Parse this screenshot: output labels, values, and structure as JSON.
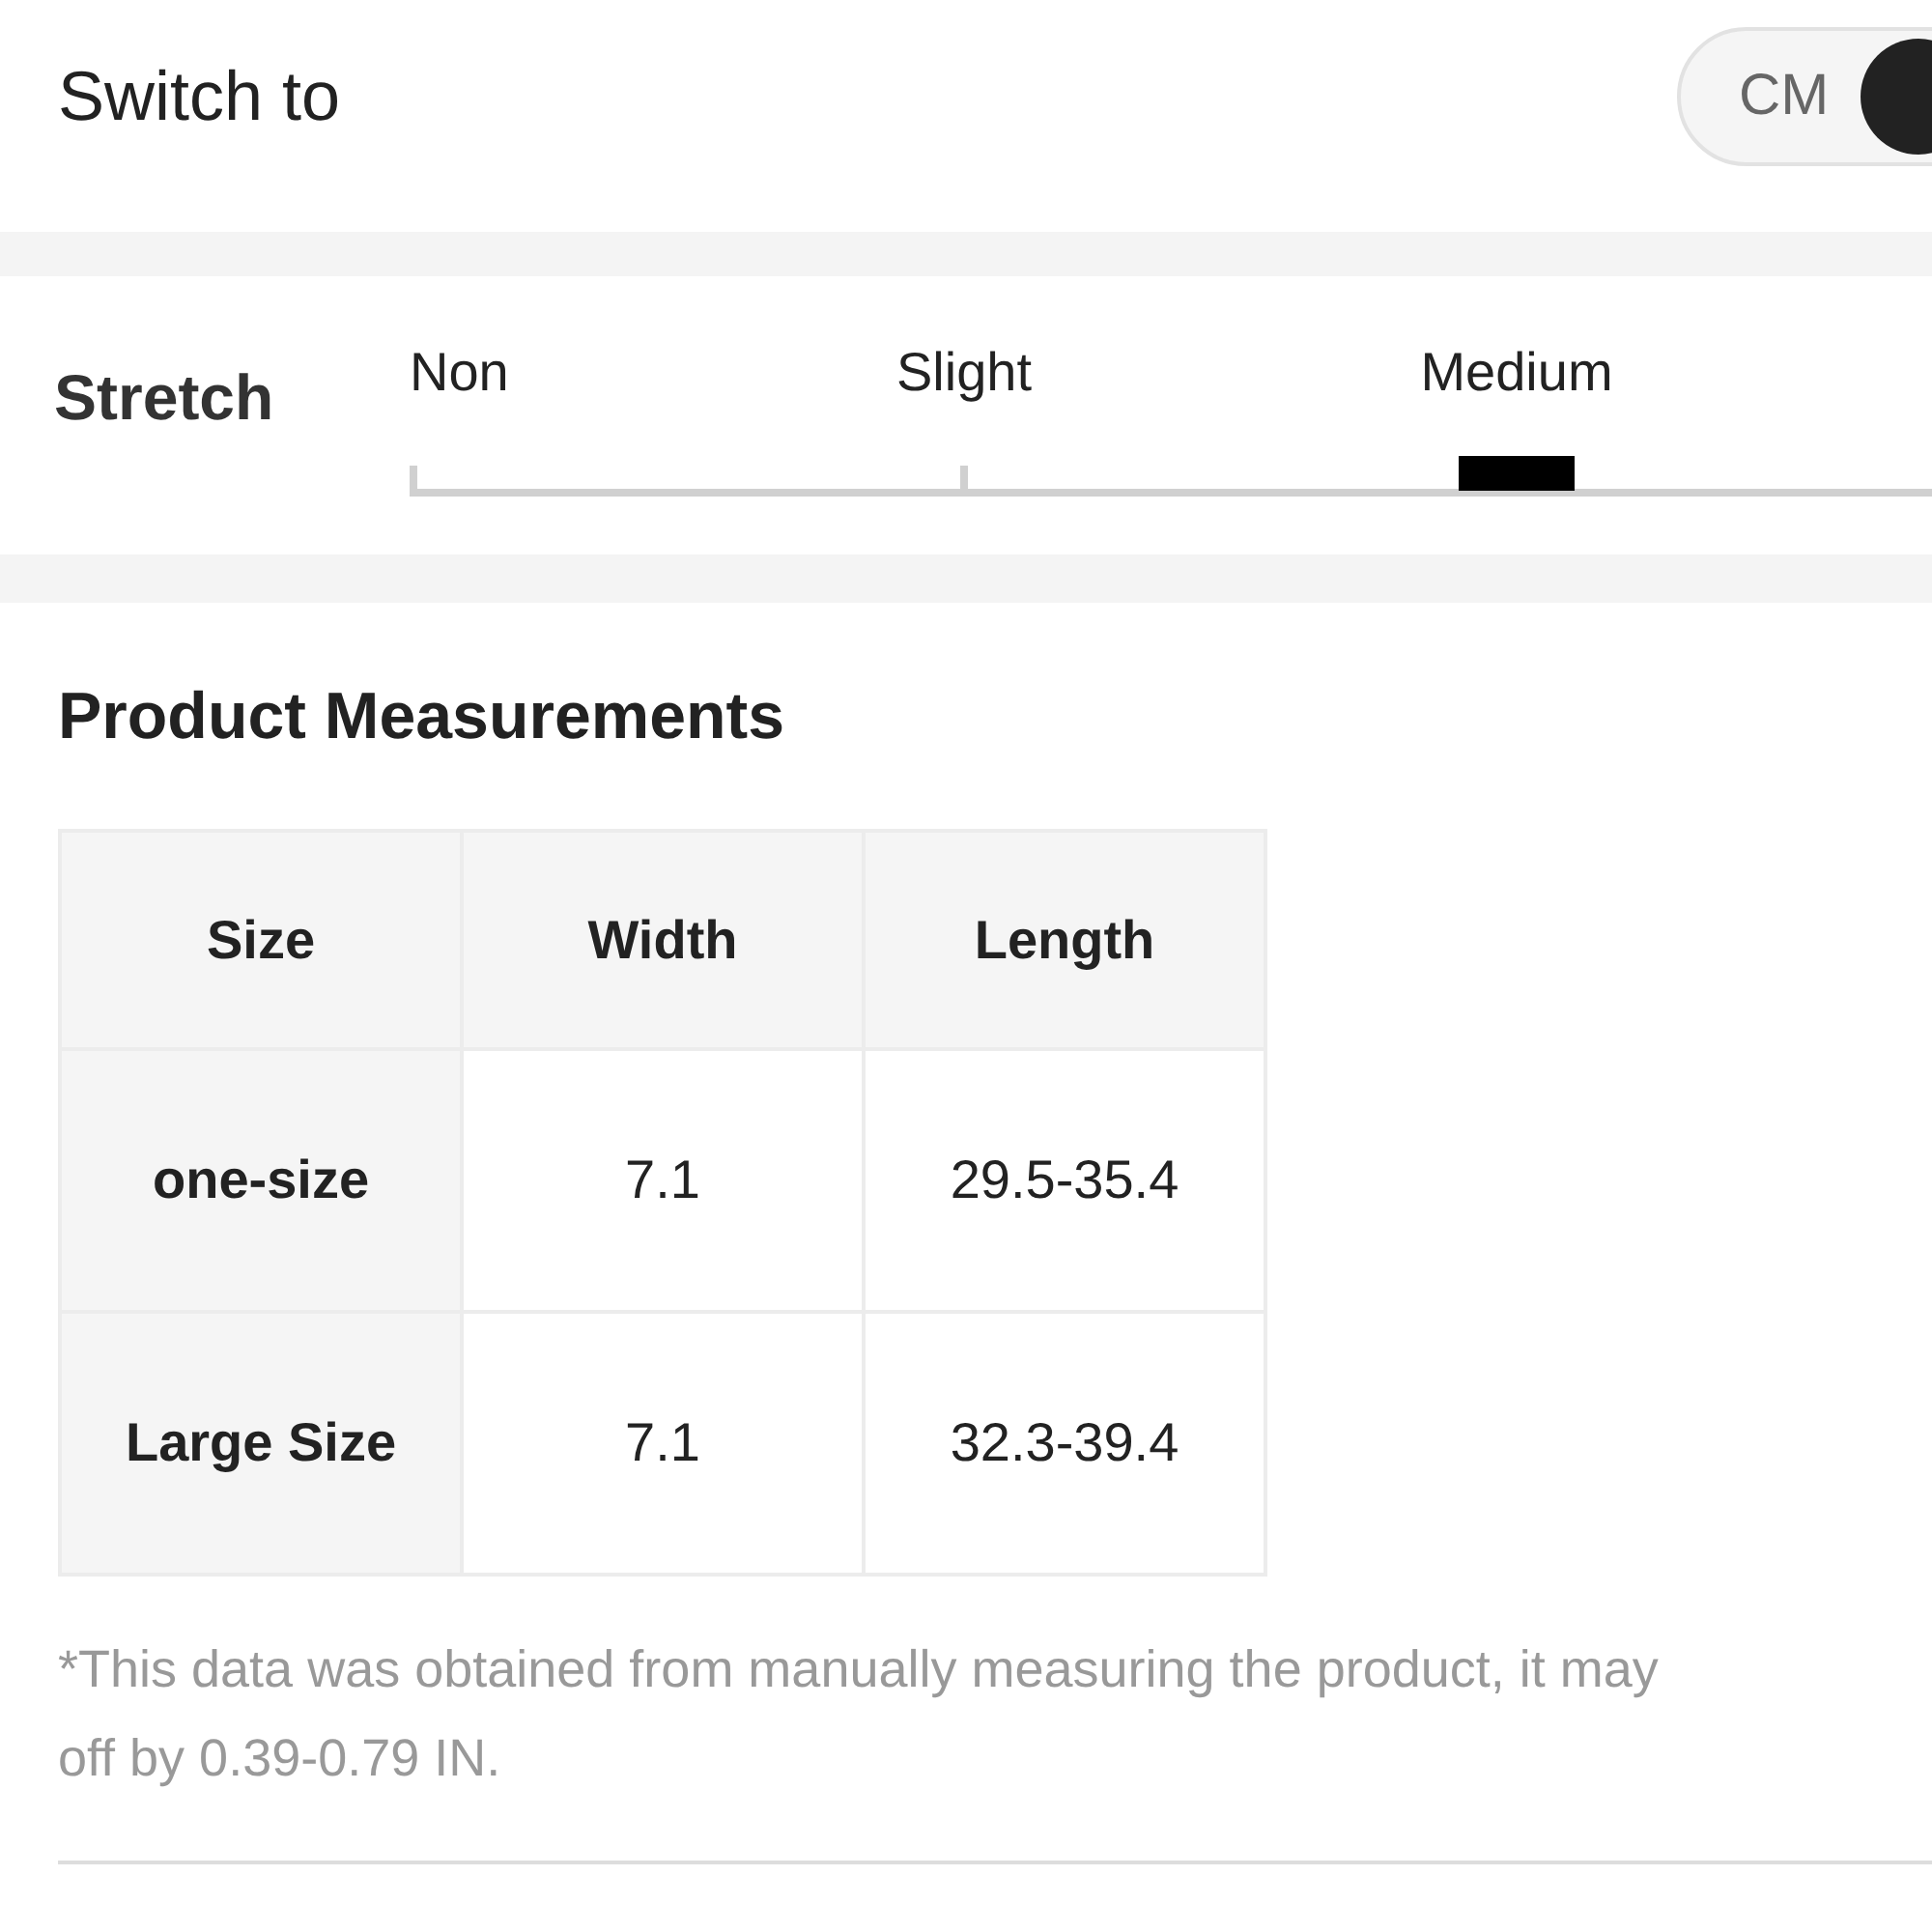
{
  "header": {
    "title": "Switch to",
    "unit_toggle": [
      {
        "label": "CM",
        "selected": false
      },
      {
        "selected": true
      }
    ]
  },
  "stretch": {
    "label": "Stretch",
    "levels": [
      {
        "label": "Non",
        "selected": false
      },
      {
        "label": "Slight",
        "selected": false
      },
      {
        "label": "Medium",
        "selected": true
      }
    ]
  },
  "measurements": {
    "title": "Product Measurements",
    "columns": [
      "Size",
      "Width",
      "Length"
    ],
    "rows": [
      [
        "one-size",
        "7.1",
        "29.5-35.4"
      ],
      [
        "Large Size",
        "7.1",
        "32.3-39.4"
      ]
    ],
    "note_lines": [
      "*This data was obtained from manually measuring the product, it may",
      "off by 0.39-0.79 IN."
    ]
  }
}
